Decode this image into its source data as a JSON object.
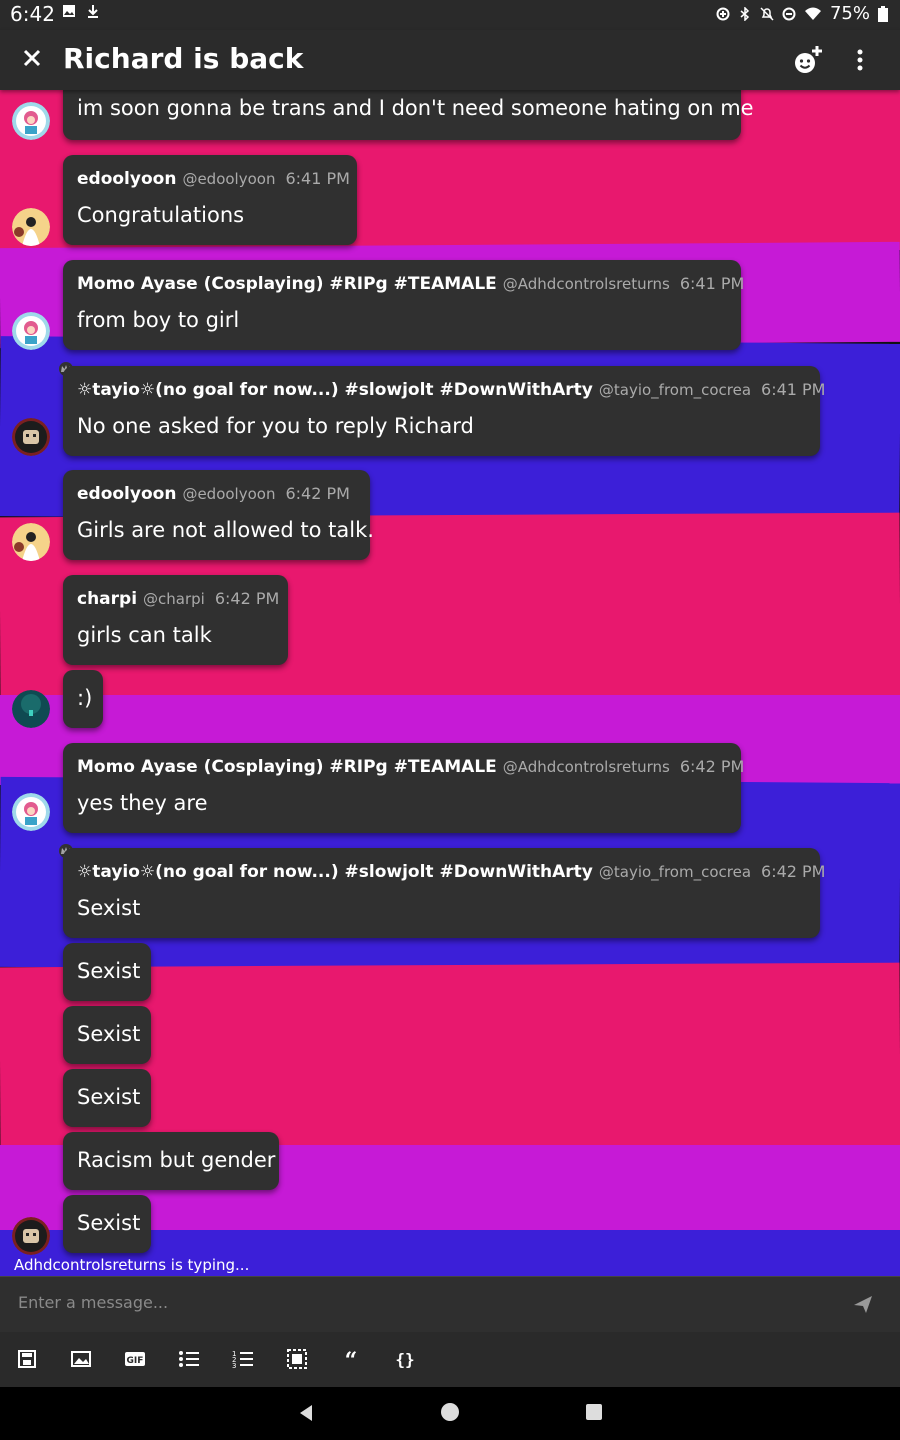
{
  "status_bar": {
    "time": "6:42",
    "battery": "75%"
  },
  "app_bar": {
    "title": "Richard is back"
  },
  "messages": [
    {
      "name": "",
      "handle": "",
      "time": "",
      "text": "im soon gonna be trans and I don't need someone hating on me"
    },
    {
      "name": "edoolyoon",
      "handle": "@edoolyoon",
      "time": "6:41 PM",
      "text": "Congratulations"
    },
    {
      "name": "Momo Ayase (Cosplaying) #RIPg #TEAMALE",
      "handle": "@Adhdcontrolsreturns",
      "time": "6:41 PM",
      "text": "from boy to girl"
    },
    {
      "name": "☼tayio☼(no goal for now...) #slowjolt #DownWithArty",
      "handle": "@tayio_from_cocrea",
      "time": "6:41 PM",
      "text": "No one asked for you to reply Richard"
    },
    {
      "name": "edoolyoon",
      "handle": "@edoolyoon",
      "time": "6:42 PM",
      "text": "Girls are not allowed to talk."
    },
    {
      "name": "charpi",
      "handle": "@charpi",
      "time": "6:42 PM",
      "text": "girls can talk"
    },
    {
      "name": "",
      "handle": "",
      "time": "",
      "text": ":)"
    },
    {
      "name": "Momo Ayase (Cosplaying) #RIPg #TEAMALE",
      "handle": "@Adhdcontrolsreturns",
      "time": "6:42 PM",
      "text": "yes they are"
    },
    {
      "name": "☼tayio☼(no goal for now...) #slowjolt #DownWithArty",
      "handle": "@tayio_from_cocrea",
      "time": "6:42 PM",
      "text": "Sexist"
    },
    {
      "name": "",
      "handle": "",
      "time": "",
      "text": "Sexist"
    },
    {
      "name": "",
      "handle": "",
      "time": "",
      "text": "Sexist"
    },
    {
      "name": "",
      "handle": "",
      "time": "",
      "text": "Sexist"
    },
    {
      "name": "",
      "handle": "",
      "time": "",
      "text": "Racism but gender"
    },
    {
      "name": "",
      "handle": "",
      "time": "",
      "text": "Sexist"
    }
  ],
  "typing_indicator": "Adhdcontrolsreturns is typing...",
  "composer": {
    "placeholder": "Enter a message..."
  },
  "toolbar_icons": [
    "save-icon",
    "image-icon",
    "gif-icon",
    "bullet-list-icon",
    "numbered-list-icon",
    "spoiler-icon",
    "quote-icon",
    "code-block-icon"
  ],
  "colors": {
    "pink": "#e8186e",
    "magenta": "#c61ad6",
    "blue": "#3c1fd8",
    "bubble": "#303030",
    "bar": "#2b2b2b"
  }
}
